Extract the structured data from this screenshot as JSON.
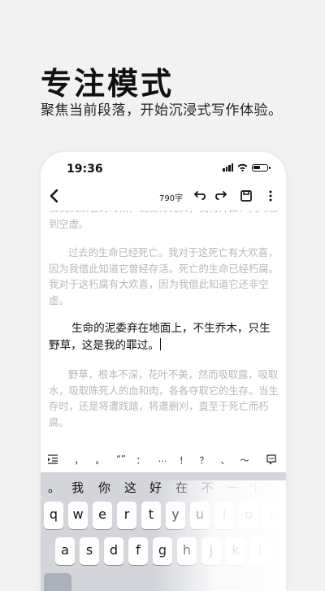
{
  "promo": {
    "title": "专注模式",
    "subtitle": "聚焦当前段落，开始沉浸式写作体验。"
  },
  "status_bar": {
    "time": "19:36"
  },
  "toolbar": {
    "word_count": "790字"
  },
  "editor": {
    "para_top": "当我沉默着的时候，我觉得充实；我将开口，同时感到空虚。",
    "para_2": "过去的生命已经死亡。我对于这死亡有大欢喜，因为我借此知道它曾经存活。死亡的生命已经朽腐。我对于这朽腐有大欢喜，因为我借此知道它还非空虚。",
    "para_active": "生命的泥委弃在地面上，不生乔木，只生野草，这是我的罪过。",
    "para_4": "野草，根本不深，花叶不美，然而吸取露，吸取水，吸取陈死人的血和肉，各各夺取它的生存。当生存时，还是将遭践踏，将遭删刈，直至于死亡而朽腐。"
  },
  "punctuation_bar": [
    "，",
    "。",
    "“”",
    "：",
    "…",
    "！",
    "？",
    "、",
    "～"
  ],
  "keyboard": {
    "candidates": [
      "。",
      "我",
      "你",
      "这",
      "好",
      "在",
      "不",
      "一",
      "个"
    ],
    "row1": [
      "q",
      "w",
      "e",
      "r",
      "t",
      "y",
      "u",
      "i",
      "o",
      "p"
    ],
    "row2": [
      "a",
      "s",
      "d",
      "f",
      "g",
      "h",
      "j",
      "k",
      "l"
    ]
  }
}
